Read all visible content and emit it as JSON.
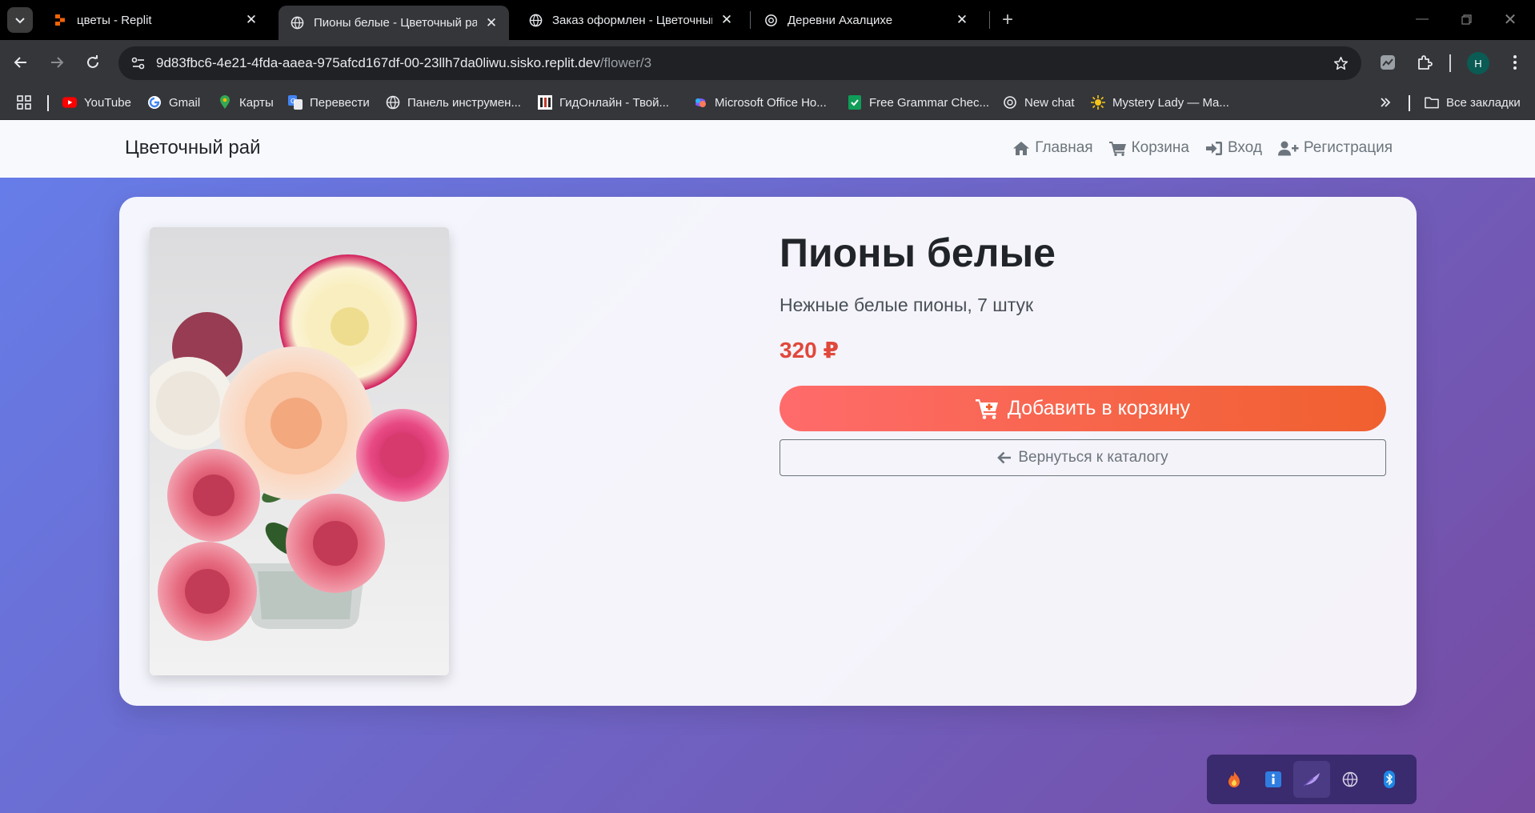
{
  "browser": {
    "tabs": [
      {
        "title": "цветы - Replit",
        "active": false
      },
      {
        "title": "Пионы белые - Цветочный рай",
        "active": true
      },
      {
        "title": "Заказ оформлен - Цветочный рай",
        "active": false
      },
      {
        "title": "Деревни Ахалцихе",
        "active": false
      }
    ],
    "url_host": "9d83fbc6-4e21-4fda-aaea-975afcd167df-00-23llh7da0liwu.sisko.replit.dev",
    "url_path": "/flower/3",
    "profile_initial": "H",
    "bookmarks": [
      {
        "label": "YouTube",
        "icon": "youtube-icon"
      },
      {
        "label": "Gmail",
        "icon": "google-icon"
      },
      {
        "label": "Карты",
        "icon": "maps-icon"
      },
      {
        "label": "Перевести",
        "icon": "translate-icon"
      },
      {
        "label": "Панель инструмен...",
        "icon": "globe-icon"
      },
      {
        "label": "ГидОнлайн - Твой...",
        "icon": "gidonline-icon"
      },
      {
        "label": "Microsoft Office Ho...",
        "icon": "office-icon"
      },
      {
        "label": "Free Grammar Chec...",
        "icon": "grammar-icon"
      },
      {
        "label": "New chat",
        "icon": "openai-icon"
      },
      {
        "label": "Mystery Lady — Ma...",
        "icon": "sun-icon"
      }
    ],
    "all_bookmarks": "Все закладки"
  },
  "site": {
    "brand": "Цветочный рай",
    "nav": {
      "home": "Главная",
      "cart": "Корзина",
      "login": "Вход",
      "register": "Регистрация"
    }
  },
  "product": {
    "title": "Пионы белые",
    "description": "Нежные белые пионы, 7 штук",
    "price": "320 ₽",
    "add_to_cart": "Добавить в корзину",
    "back": "Вернуться к каталогу"
  },
  "colors": {
    "gradient_start": "#667eea",
    "gradient_end": "#764ba2",
    "price": "#e0483b",
    "cta_start": "#ff6b6b",
    "cta_end": "#f0602e"
  }
}
